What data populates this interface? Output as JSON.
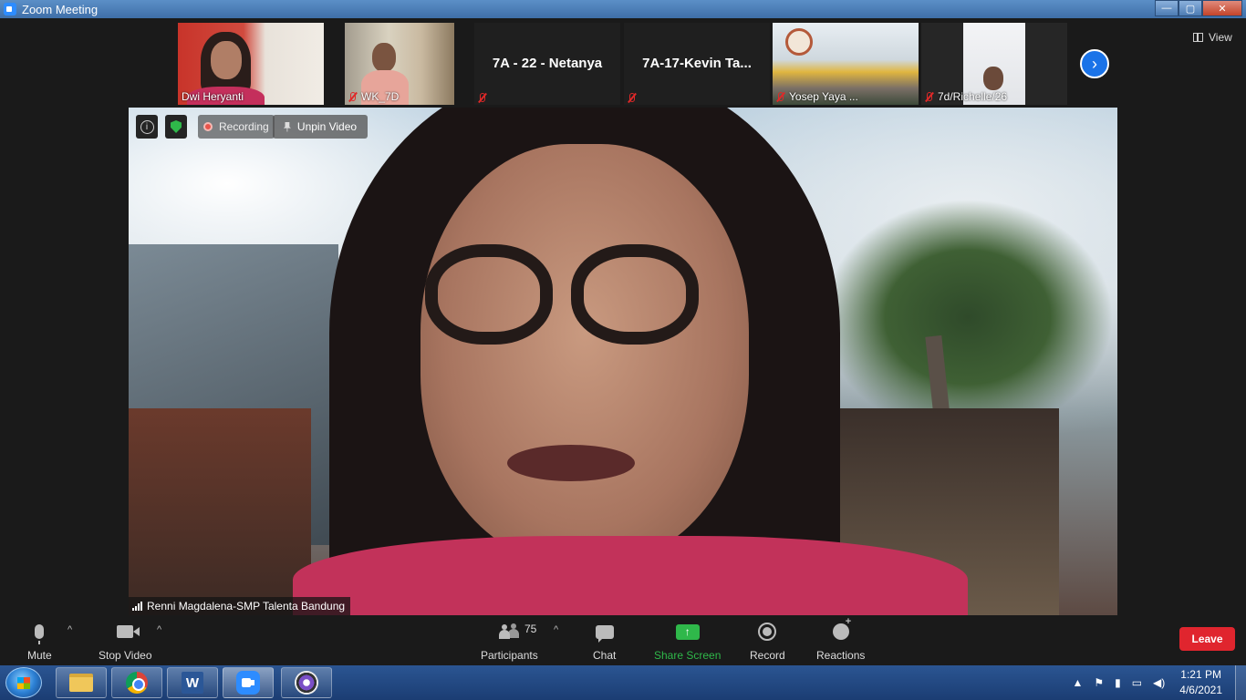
{
  "window": {
    "title": "Zoom Meeting",
    "controls": {
      "minimize": "—",
      "maximize": "▢",
      "close": "✕"
    }
  },
  "thumbnails": [
    {
      "name": "Dwi Heryanti",
      "muted": false,
      "video": true
    },
    {
      "name": "WK_7D",
      "muted": true,
      "video": true
    },
    {
      "name": "7A - 22 - Netanya",
      "muted": true,
      "video": false
    },
    {
      "name": "7A-17-Kevin Ta...",
      "muted": true,
      "video": false
    },
    {
      "name": "Yosep Yaya ...",
      "muted": true,
      "video": true
    },
    {
      "name": "7d/Richelle/26",
      "muted": true,
      "video": true
    }
  ],
  "strip": {
    "next_icon": "chevron-right-icon",
    "view_label": "View"
  },
  "main_video": {
    "recording_label": "Recording",
    "unpin_label": "Unpin Video",
    "info_symbol": "i",
    "speaker_name": "Renni Magdalena-SMP Talenta Bandung"
  },
  "toolbar": {
    "mute_label": "Mute",
    "stop_video_label": "Stop Video",
    "participants_label": "Participants",
    "participants_count": "75",
    "chat_label": "Chat",
    "share_screen_label": "Share Screen",
    "record_label": "Record",
    "reactions_label": "Reactions",
    "leave_label": "Leave",
    "caret": "^"
  },
  "taskbar": {
    "word_letter": "W",
    "time": "1:21 PM",
    "date": "4/6/2021"
  },
  "colors": {
    "zoom_blue": "#2d8cff",
    "share_green": "#2fb84a",
    "leave_red": "#e0252e",
    "mute_red": "#e02828"
  }
}
